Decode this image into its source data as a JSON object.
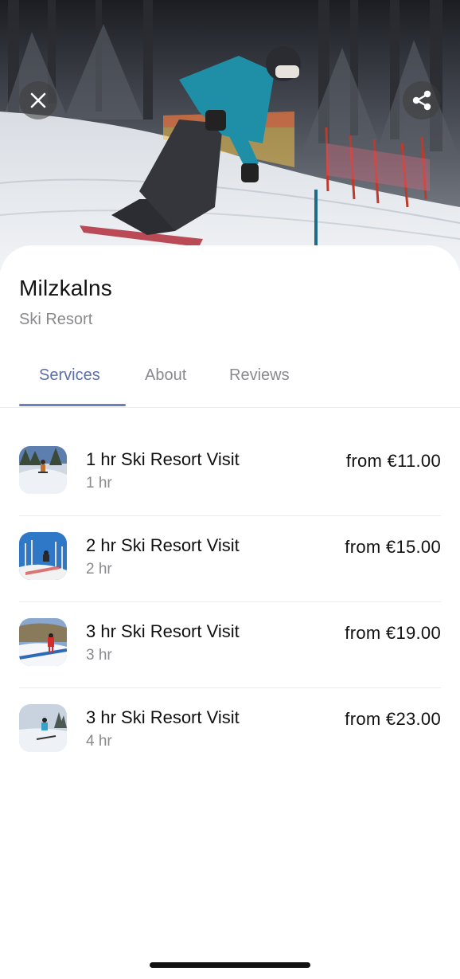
{
  "header": {
    "close_icon": "close-icon",
    "share_icon": "share-icon"
  },
  "business": {
    "name": "Milzkalns",
    "category": "Ski Resort"
  },
  "tabs": [
    {
      "label": "Services",
      "active": true
    },
    {
      "label": "About",
      "active": false
    },
    {
      "label": "Reviews",
      "active": false
    }
  ],
  "services": [
    {
      "title": "1 hr Ski Resort Visit",
      "duration": "1 hr",
      "price": "from €11.00"
    },
    {
      "title": "2 hr Ski Resort Visit",
      "duration": "2 hr",
      "price": "from €15.00"
    },
    {
      "title": "3 hr Ski Resort Visit",
      "duration": "3 hr",
      "price": "from €19.00"
    },
    {
      "title": "3 hr Ski Resort Visit",
      "duration": "4 hr",
      "price": "from €23.00"
    }
  ],
  "colors": {
    "accent": "#5b6fa8",
    "muted_text": "#8a8a8e",
    "divider": "#ececec"
  }
}
